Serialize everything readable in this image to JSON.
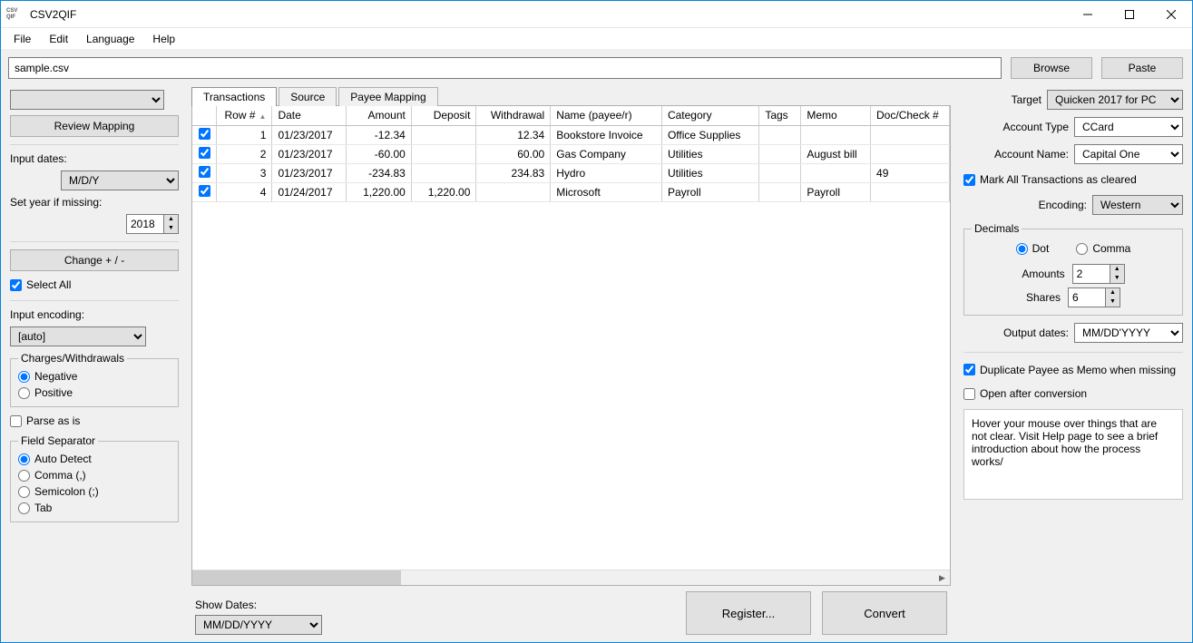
{
  "app": {
    "title": "CSV2QIF",
    "icon_top": "CSV",
    "icon_bottom": "QIF"
  },
  "menubar": [
    "File",
    "Edit",
    "Language",
    "Help"
  ],
  "file_row": {
    "path": "sample.csv",
    "browse": "Browse",
    "paste": "Paste"
  },
  "left": {
    "review_mapping": "Review Mapping",
    "input_dates_label": "Input dates:",
    "input_dates_value": "M/D/Y",
    "set_year_label": "Set year if missing:",
    "set_year_value": "2018",
    "change_sign": "Change + / -",
    "select_all": "Select All",
    "input_encoding_label": "Input encoding:",
    "input_encoding_value": "[auto]",
    "charges_group": "Charges/Withdrawals",
    "charges_negative": "Negative",
    "charges_positive": "Positive",
    "parse_as_is": "Parse as is",
    "field_sep_group": "Field Separator",
    "sep_auto": "Auto Detect",
    "sep_comma": "Comma (,)",
    "sep_semi": "Semicolon (;)",
    "sep_tab": "Tab"
  },
  "tabs": {
    "transactions": "Transactions",
    "source": "Source",
    "payee": "Payee Mapping"
  },
  "grid": {
    "columns": [
      "",
      "Row #",
      "Date",
      "Amount",
      "Deposit",
      "Withdrawal",
      "Name (payee/r)",
      "Category",
      "Tags",
      "Memo",
      "Doc/Check #"
    ],
    "rows": [
      {
        "checked": true,
        "row": "1",
        "date": "01/23/2017",
        "amount": "-12.34",
        "deposit": "",
        "withdrawal": "12.34",
        "name": "Bookstore Invoice",
        "category": "Office Supplies",
        "tags": "",
        "memo": "",
        "doc": ""
      },
      {
        "checked": true,
        "row": "2",
        "date": "01/23/2017",
        "amount": "-60.00",
        "deposit": "",
        "withdrawal": "60.00",
        "name": "Gas Company",
        "category": "Utilities",
        "tags": "",
        "memo": "August bill",
        "doc": ""
      },
      {
        "checked": true,
        "row": "3",
        "date": "01/23/2017",
        "amount": "-234.83",
        "deposit": "",
        "withdrawal": "234.83",
        "name": "Hydro",
        "category": "Utilities",
        "tags": "",
        "memo": "",
        "doc": "49"
      },
      {
        "checked": true,
        "row": "4",
        "date": "01/24/2017",
        "amount": "1,220.00",
        "deposit": "1,220.00",
        "withdrawal": "",
        "name": "Microsoft",
        "category": "Payroll",
        "tags": "",
        "memo": "Payroll",
        "doc": ""
      }
    ]
  },
  "center_bottom": {
    "show_dates_label": "Show Dates:",
    "show_dates_value": "MM/DD/YYYY",
    "register": "Register...",
    "convert": "Convert"
  },
  "right": {
    "target_label": "Target",
    "target_value": "Quicken 2017 for PC",
    "account_type_label": "Account Type",
    "account_type_value": "CCard",
    "account_name_label": "Account Name:",
    "account_name_value": "Capital One",
    "mark_cleared": "Mark All Transactions as cleared",
    "encoding_label": "Encoding:",
    "encoding_value": "Western",
    "decimals_group": "Decimals",
    "dec_dot": "Dot",
    "dec_comma": "Comma",
    "amounts_label": "Amounts",
    "amounts_value": "2",
    "shares_label": "Shares",
    "shares_value": "6",
    "output_dates_label": "Output dates:",
    "output_dates_value": "MM/DD'YYYY",
    "dup_payee": "Duplicate Payee as Memo when missing",
    "open_after": "Open after conversion",
    "hint": "Hover your mouse over things that are not clear. Visit Help page to see a brief introduction about how the process works/"
  }
}
